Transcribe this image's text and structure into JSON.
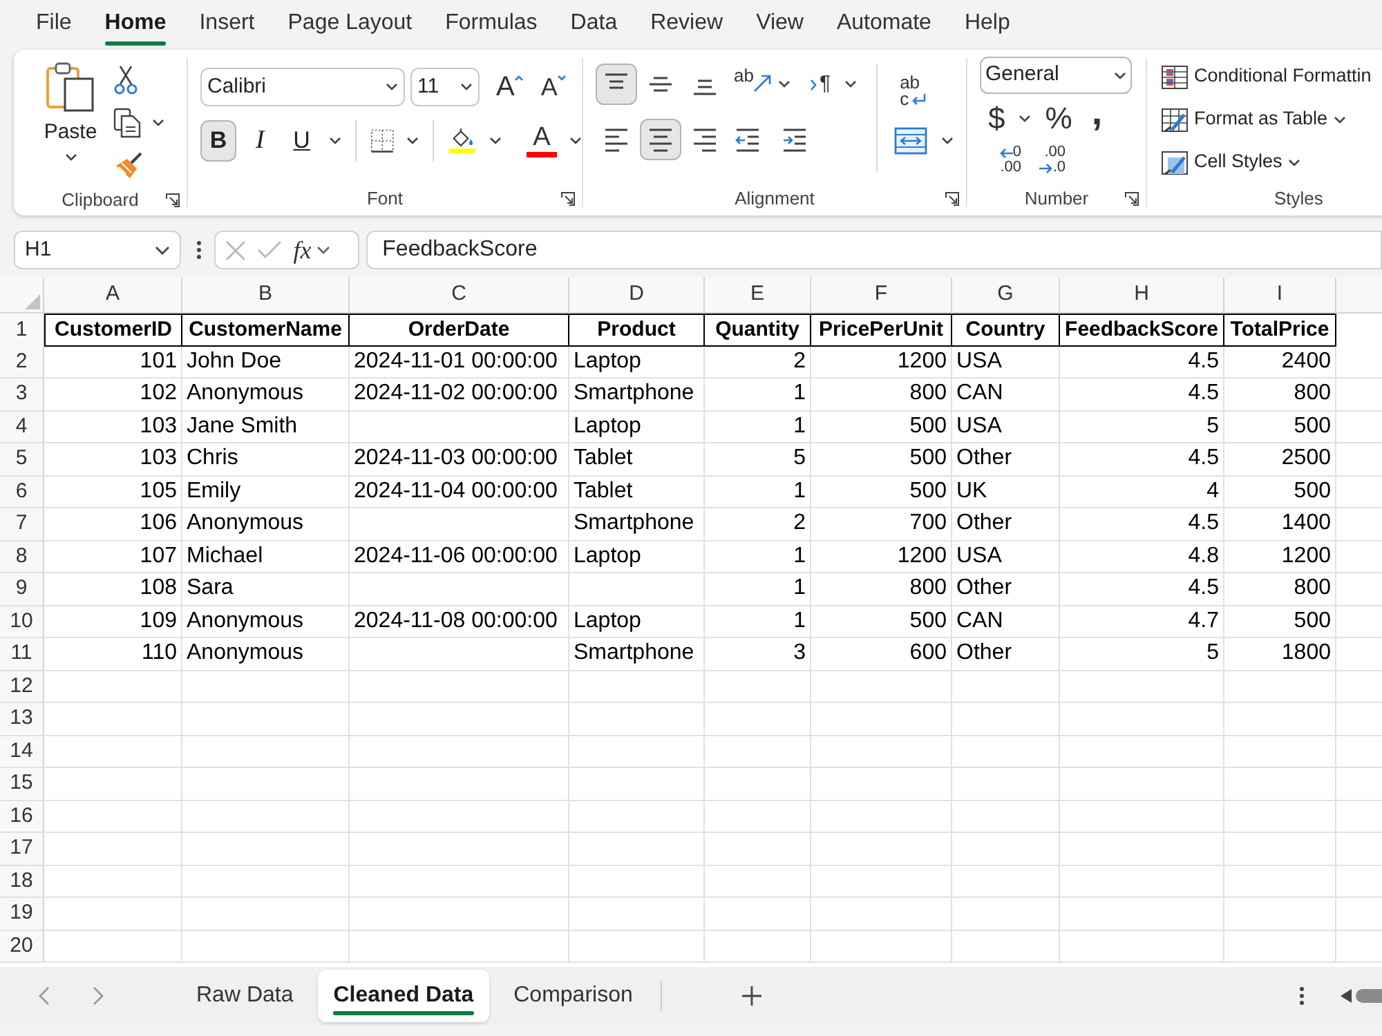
{
  "menu_tabs": [
    {
      "label": "File",
      "selected": false
    },
    {
      "label": "Home",
      "selected": true
    },
    {
      "label": "Insert",
      "selected": false
    },
    {
      "label": "Page Layout",
      "selected": false
    },
    {
      "label": "Formulas",
      "selected": false
    },
    {
      "label": "Data",
      "selected": false
    },
    {
      "label": "Review",
      "selected": false
    },
    {
      "label": "View",
      "selected": false
    },
    {
      "label": "Automate",
      "selected": false
    },
    {
      "label": "Help",
      "selected": false
    }
  ],
  "ribbon": {
    "clipboard": {
      "title": "Clipboard",
      "paste_label": "Paste"
    },
    "font": {
      "title": "Font",
      "font_name": "Calibri",
      "font_size": "11",
      "grow_label": "A",
      "shrink_label": "A",
      "styles": [
        {
          "kind": "bold",
          "label": "B",
          "selected": true
        },
        {
          "kind": "italic",
          "label": "I",
          "selected": false
        },
        {
          "kind": "underline",
          "label": "U",
          "selected": false
        }
      ],
      "fill": {
        "color": "#ffff00"
      },
      "font_color": {
        "label": "A",
        "color": "#ff0000"
      }
    },
    "alignment": {
      "title": "Alignment",
      "vertical": [
        {
          "kind": "top",
          "selected": true
        },
        {
          "kind": "middle",
          "selected": false
        },
        {
          "kind": "bottom",
          "selected": false
        }
      ],
      "orientation_label": "ab",
      "direction_label": "¶",
      "wrap_label": {
        "upper": "ab",
        "lower": "c"
      },
      "horizontal": [
        {
          "kind": "left",
          "selected": false
        },
        {
          "kind": "center",
          "selected": true
        },
        {
          "kind": "right",
          "selected": false
        }
      ]
    },
    "number": {
      "title": "Number",
      "format": "General",
      "currency": "$",
      "percent": "%",
      "comma": ",",
      "decimals": [
        {
          "kind": "decrease",
          "upper": "0",
          "lower": ".00"
        },
        {
          "kind": "increase",
          "upper": ".00",
          "lower": ".0"
        }
      ]
    },
    "styles": {
      "title": "Styles",
      "items": [
        {
          "kind": "conditional",
          "label": "Conditional Formattin",
          "dropdown": false
        },
        {
          "kind": "table",
          "label": "Format as Table",
          "dropdown": true
        },
        {
          "kind": "cell",
          "label": "Cell Styles",
          "dropdown": true
        }
      ]
    }
  },
  "formula_bar": {
    "name_box": "H1",
    "function_label": "fx",
    "formula": "FeedbackScore"
  },
  "sheet": {
    "column_letters": [
      "A",
      "B",
      "C",
      "D",
      "E",
      "F",
      "G",
      "H",
      "I"
    ],
    "rows": [
      {
        "number": "1",
        "kind": "header",
        "cells": [
          "CustomerID",
          "CustomerName",
          "OrderDate",
          "Product",
          "Quantity",
          "PricePerUnit",
          "Country",
          "FeedbackScore",
          "TotalPrice"
        ]
      },
      {
        "number": "2",
        "kind": "data",
        "cells": [
          "101",
          "John Doe",
          "2024-11-01 00:00:00",
          "Laptop",
          "2",
          "1200",
          "USA",
          "4.5",
          "2400"
        ]
      },
      {
        "number": "3",
        "kind": "data",
        "cells": [
          "102",
          "Anonymous",
          "2024-11-02 00:00:00",
          "Smartphone",
          "1",
          "800",
          "CAN",
          "4.5",
          "800"
        ]
      },
      {
        "number": "4",
        "kind": "data",
        "cells": [
          "103",
          "Jane Smith",
          null,
          "Laptop",
          "1",
          "500",
          "USA",
          "5",
          "500"
        ]
      },
      {
        "number": "5",
        "kind": "data",
        "cells": [
          "103",
          "Chris",
          "2024-11-03 00:00:00",
          "Tablet",
          "5",
          "500",
          "Other",
          "4.5",
          "2500"
        ]
      },
      {
        "number": "6",
        "kind": "data",
        "cells": [
          "105",
          "Emily",
          "2024-11-04 00:00:00",
          "Tablet",
          "1",
          "500",
          "UK",
          "4",
          "500"
        ]
      },
      {
        "number": "7",
        "kind": "data",
        "cells": [
          "106",
          "Anonymous",
          null,
          "Smartphone",
          "2",
          "700",
          "Other",
          "4.5",
          "1400"
        ]
      },
      {
        "number": "8",
        "kind": "data",
        "cells": [
          "107",
          "Michael",
          "2024-11-06 00:00:00",
          "Laptop",
          "1",
          "1200",
          "USA",
          "4.8",
          "1200"
        ]
      },
      {
        "number": "9",
        "kind": "data",
        "cells": [
          "108",
          "Sara",
          null,
          null,
          "1",
          "800",
          "Other",
          "4.5",
          "800"
        ]
      },
      {
        "number": "10",
        "kind": "data",
        "cells": [
          "109",
          "Anonymous",
          "2024-11-08 00:00:00",
          "Laptop",
          "1",
          "500",
          "CAN",
          "4.7",
          "500"
        ]
      },
      {
        "number": "11",
        "kind": "data",
        "cells": [
          "110",
          "Anonymous",
          null,
          "Smartphone",
          "3",
          "600",
          "Other",
          "5",
          "1800"
        ]
      },
      {
        "number": "12",
        "kind": "data"
      },
      {
        "number": "13",
        "kind": "data"
      },
      {
        "number": "14",
        "kind": "data"
      },
      {
        "number": "15",
        "kind": "data"
      },
      {
        "number": "16",
        "kind": "data"
      },
      {
        "number": "17",
        "kind": "data"
      },
      {
        "number": "18",
        "kind": "data"
      },
      {
        "number": "19",
        "kind": "data"
      },
      {
        "number": "20",
        "kind": "data"
      }
    ]
  },
  "sheet_tabs": [
    {
      "label": "Raw Data",
      "selected": false
    },
    {
      "label": "Cleaned Data",
      "selected": true
    },
    {
      "label": "Comparison",
      "selected": false
    }
  ]
}
